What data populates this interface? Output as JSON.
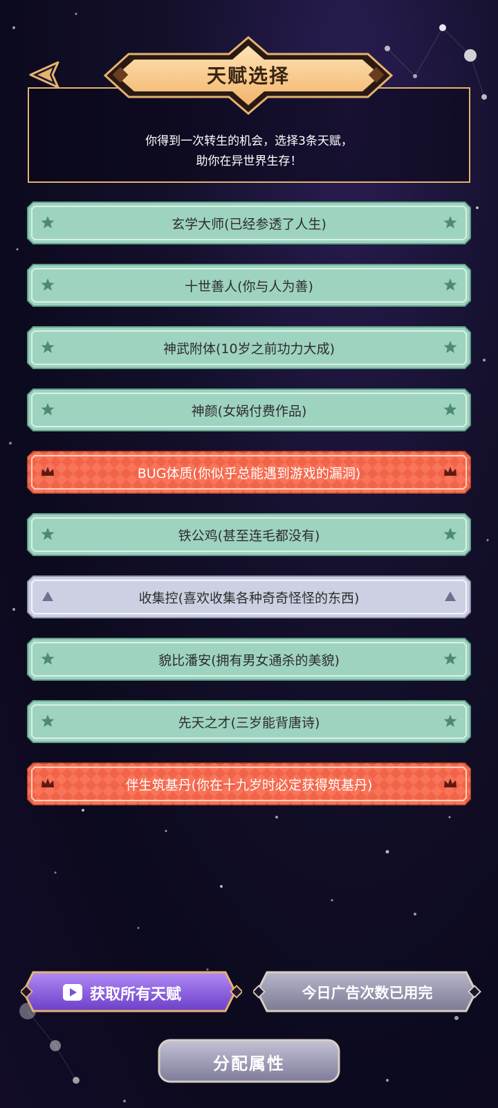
{
  "header": {
    "title": "天赋选择",
    "intro_line1": "你得到一次转生的机会，选择3条天赋，",
    "intro_line2": "助你在异世界生存！"
  },
  "talents": [
    {
      "label": "玄学大师(已经参透了人生)",
      "rarity": "green"
    },
    {
      "label": "十世善人(你与人为善)",
      "rarity": "green"
    },
    {
      "label": "神武附体(10岁之前功力大成)",
      "rarity": "green"
    },
    {
      "label": "神颜(女娲付费作品)",
      "rarity": "green"
    },
    {
      "label": "BUG体质(你似乎总能遇到游戏的漏洞)",
      "rarity": "red"
    },
    {
      "label": "铁公鸡(甚至连毛都没有)",
      "rarity": "green"
    },
    {
      "label": "收集控(喜欢收集各种奇奇怪怪的东西)",
      "rarity": "grey"
    },
    {
      "label": "貌比潘安(拥有男女通杀的美貌)",
      "rarity": "green"
    },
    {
      "label": "先天之才(三岁能背唐诗)",
      "rarity": "green"
    },
    {
      "label": "伴生筑基丹(你在十九岁时必定获得筑基丹)",
      "rarity": "red"
    }
  ],
  "buttons": {
    "get_all": "获取所有天赋",
    "ad_used": "今日广告次数已用完",
    "allocate": "分配属性"
  },
  "colors": {
    "gold": "#e6b36e",
    "green_card": "#9ed3c0",
    "red_card": "#f2644a",
    "grey_card": "#cdd0e2",
    "purple_button": "#8a5ee0"
  }
}
